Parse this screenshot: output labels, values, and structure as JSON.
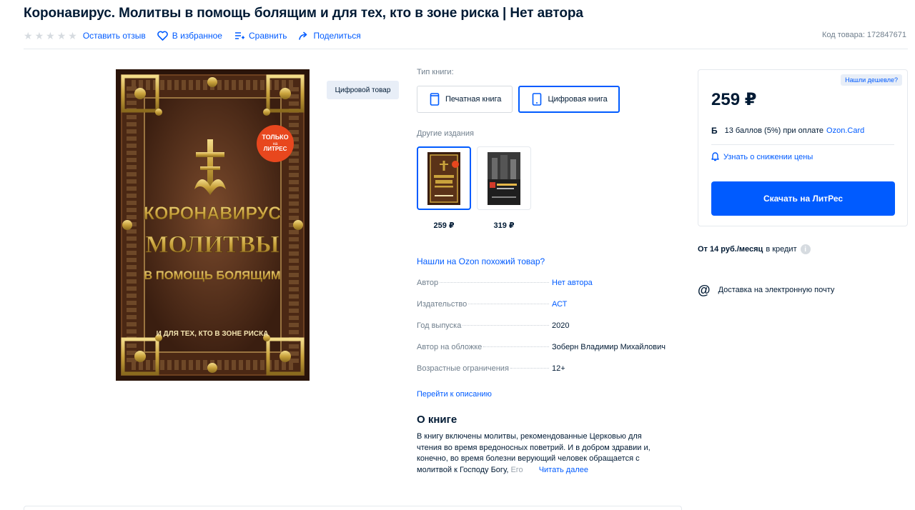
{
  "product": {
    "title": "Коронавирус. Молитвы в помощь болящим и для тех, кто в зоне риска | Нет автора",
    "sku": "Код товара: 172847671"
  },
  "actions": {
    "review": "Оставить отзыв",
    "favorite": "В избранное",
    "compare": "Сравнить",
    "share": "Поделиться"
  },
  "cover": {
    "badge_top": "ТОЛЬКО",
    "badge_mid": "на",
    "badge_bottom": "ЛИТРЕС",
    "line1": "КОРОНАВИРУС",
    "line2": "МОЛИТВЫ",
    "line3": "В ПОМОЩЬ БОЛЯЩИМ",
    "line4": "И ДЛЯ ТЕХ, КТО В ЗОНЕ РИСКА"
  },
  "digital_tag": "Цифровой товар",
  "book_type": {
    "label": "Тип книги:",
    "options": [
      "Печатная книга",
      "Цифровая книга"
    ],
    "selected": "Цифровая книга"
  },
  "editions": {
    "label": "Другие издания",
    "items": [
      {
        "price": "259 ₽"
      },
      {
        "price": "319 ₽"
      }
    ]
  },
  "similar_link": "Нашли на Ozon похожий товар?",
  "specs": [
    {
      "name": "Автор",
      "value": "Нет автора"
    },
    {
      "name": "Издательство",
      "value": "АСТ"
    },
    {
      "name": "Год выпуска",
      "value": "2020"
    },
    {
      "name": "Автор на обложке",
      "value": "Зоберн Владимир Михайлович"
    },
    {
      "name": "Возрастные ограничения",
      "value": "12+"
    }
  ],
  "goto_description": "Перейти к описанию",
  "about": {
    "heading": "О книге",
    "text_main": "В книгу включены молитвы, рекомендованные Церковью для чтения во время вредоносных поветрий. И в добром здравии и, конечно, во время болезни верующий человек обращается с молитвой к Господу Богу, ",
    "text_fade": "Его",
    "read_more": "Читать далее"
  },
  "price_card": {
    "cheaper": "Нашли дешевле?",
    "price": "259 ₽",
    "bonus_icon": "Б",
    "bonus_text": "13 баллов (5%) при оплате",
    "bonus_link": "Ozon.Card",
    "notify": "Узнать о снижении цены",
    "buy": "Скачать на ЛитРес"
  },
  "credit": {
    "amount": "От 14 руб./месяц",
    "text": "в кредит",
    "info_icon": "i"
  },
  "delivery": {
    "icon": "@",
    "text": "Доставка на электронную почту"
  },
  "colors": {
    "accent": "#005bff",
    "text": "#001a34",
    "muted": "#707f8d"
  }
}
